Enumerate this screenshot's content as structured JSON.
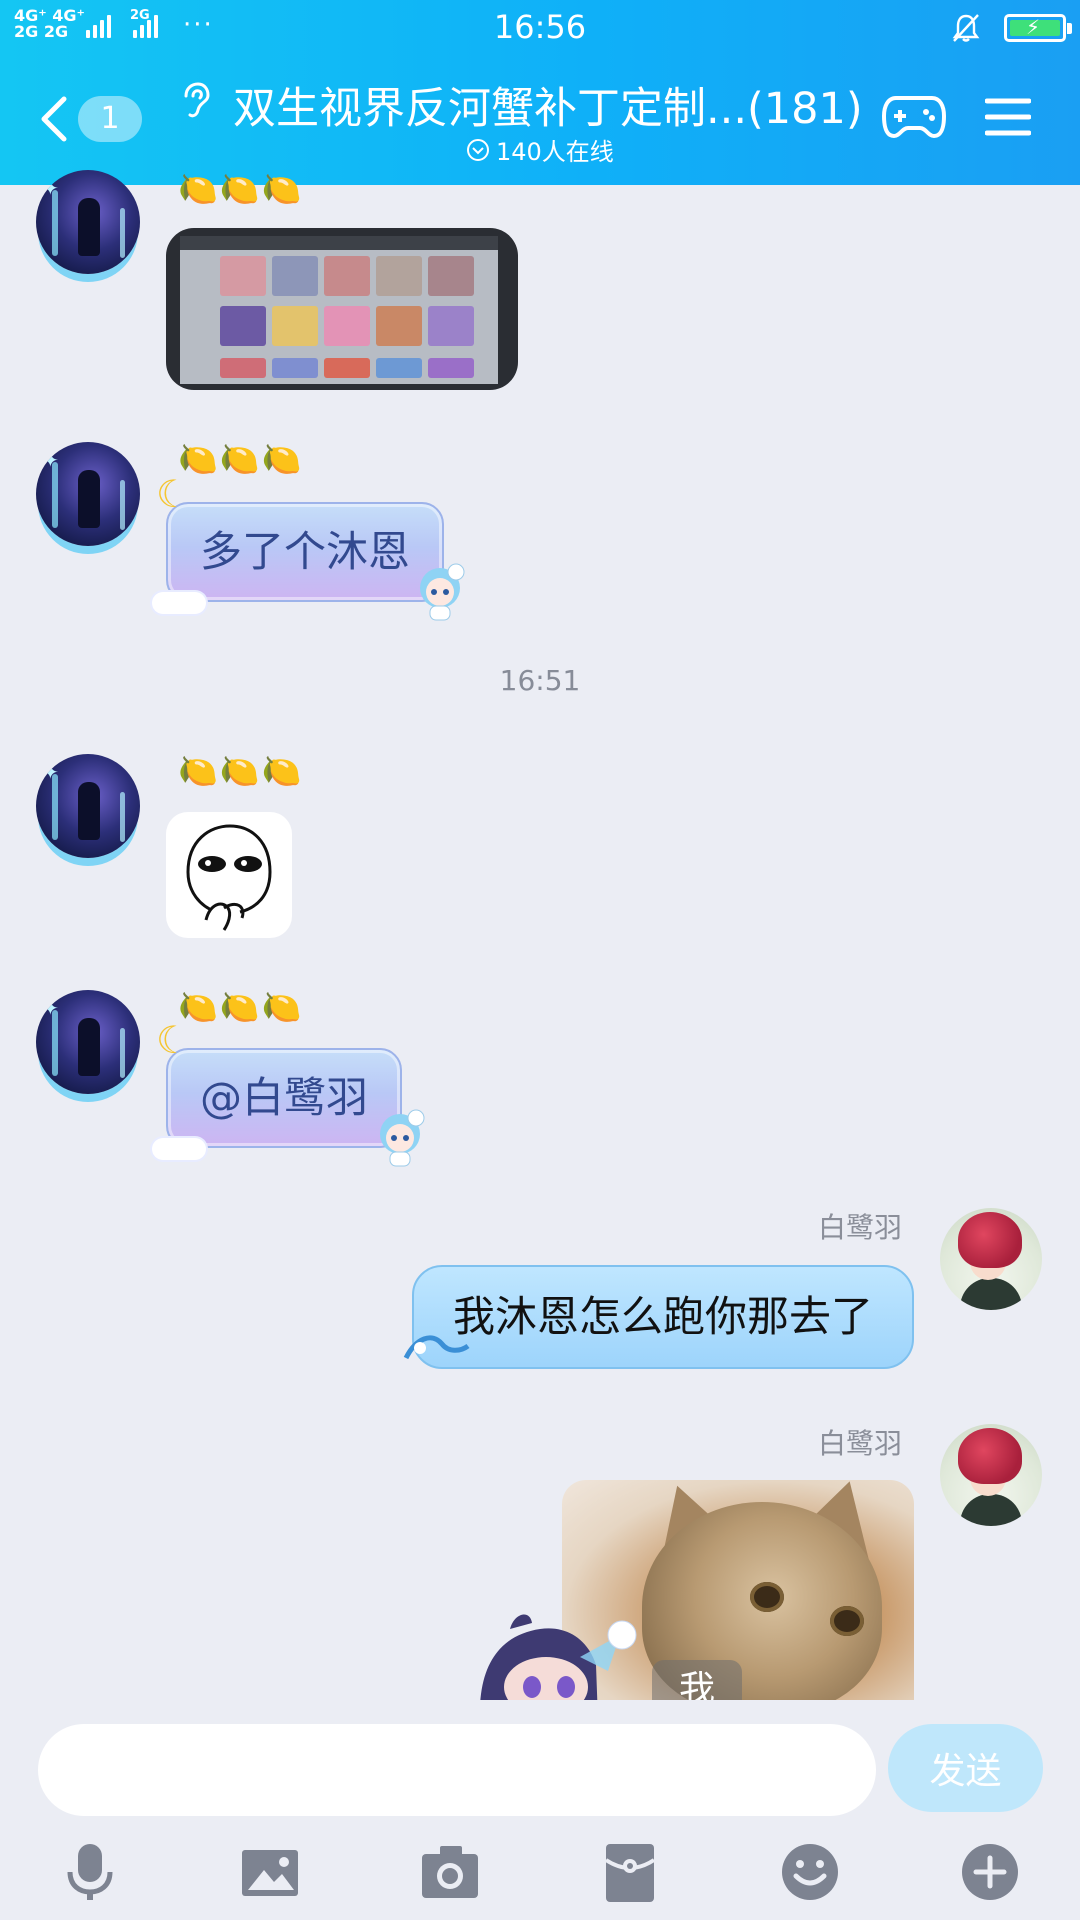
{
  "status_bar": {
    "network_1": "4G⁺ 4G⁺",
    "network_2": "2G 2G",
    "network_3": "2G",
    "more": "···",
    "time": "16:56"
  },
  "header": {
    "back_count": "1",
    "title": "双生视界反河蟹补丁定制...(181)",
    "online": "140人在线",
    "colors": {
      "gradient_start": "#14c6f3",
      "gradient_end": "#1a9ff3"
    }
  },
  "messages": [
    {
      "side": "left",
      "type": "image",
      "badge": "🍋🍋🍋"
    },
    {
      "side": "left",
      "type": "text",
      "badge": "🍋🍋🍋",
      "text": "多了个沐恩"
    },
    {
      "type": "time",
      "text": "16:51"
    },
    {
      "side": "left",
      "type": "sticker",
      "badge": "🍋🍋🍋"
    },
    {
      "side": "left",
      "type": "text",
      "badge": "🍋🍋🍋",
      "text": "@白鹭羽"
    },
    {
      "side": "right",
      "type": "text",
      "sender": "白鹭羽",
      "text": "我沐恩怎么跑你那去了"
    },
    {
      "side": "right",
      "type": "image",
      "sender": "白鹭羽",
      "overlay_text": "我"
    }
  ],
  "composer": {
    "placeholder": "",
    "send_label": "发送"
  },
  "toolbar": {
    "icons": [
      "microphone-icon",
      "image-icon",
      "camera-icon",
      "red-packet-icon",
      "emoji-icon",
      "plus-icon"
    ]
  }
}
